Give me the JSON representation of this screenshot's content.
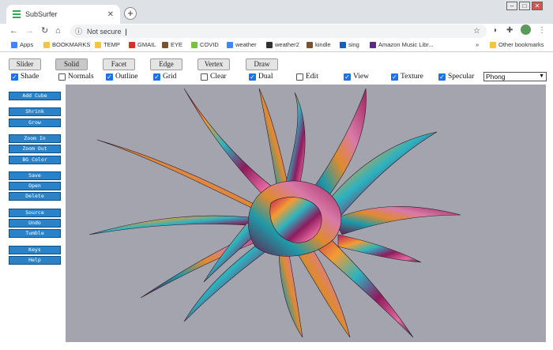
{
  "browser": {
    "tab_title": "SubSurfer",
    "address": "Not secure",
    "address_sep": "|",
    "bookmarks": [
      {
        "label": "Apps",
        "color": "#4285f4"
      },
      {
        "label": "BOOKMARKS",
        "color": "#f4c542"
      },
      {
        "label": "TEMP",
        "color": "#f4c542"
      },
      {
        "label": "GMAIL",
        "color": "#d93025"
      },
      {
        "label": "EYE",
        "color": "#7a5230"
      },
      {
        "label": "COVID",
        "color": "#7ac142"
      },
      {
        "label": "weather",
        "color": "#4285f4"
      },
      {
        "label": "weather2",
        "color": "#333333"
      },
      {
        "label": "kindle",
        "color": "#7a5230"
      },
      {
        "label": "sing",
        "color": "#1a5fb4"
      },
      {
        "label": "Amazon Music Libr...",
        "color": "#5b2a86"
      }
    ],
    "bookmarks_more": "»",
    "other_bookmarks": "Other bookmarks"
  },
  "modes": [
    "Slider",
    "Solid",
    "Facet",
    "Edge",
    "Vertex",
    "Draw"
  ],
  "active_mode": "Solid",
  "options": [
    {
      "label": "Shade",
      "checked": true
    },
    {
      "label": "Normals",
      "checked": false
    },
    {
      "label": "Outline",
      "checked": true
    },
    {
      "label": "Grid",
      "checked": true
    },
    {
      "label": "Clear",
      "checked": false
    },
    {
      "label": "Dual",
      "checked": true
    },
    {
      "label": "Edit",
      "checked": false
    },
    {
      "label": "View",
      "checked": true
    },
    {
      "label": "Texture",
      "checked": true
    },
    {
      "label": "Specular",
      "checked": true
    }
  ],
  "shading": "Phong",
  "side_buttons": [
    [
      "Add Cube"
    ],
    [
      "Shrink",
      "Grow"
    ],
    [
      "Zoom In",
      "Zoom Out",
      "BG Color"
    ],
    [
      "Save",
      "Open",
      "Delete"
    ],
    [
      "Source",
      "Undo",
      "Tumble"
    ],
    [
      "Keys",
      "Help"
    ]
  ],
  "viewport_bg": "#a3a4ae"
}
